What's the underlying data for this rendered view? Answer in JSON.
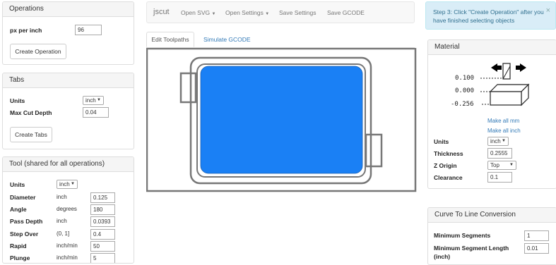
{
  "operations": {
    "title": "Operations",
    "px_per_inch_label": "px per inch",
    "px_per_inch_value": "96",
    "create_button": "Create Operation"
  },
  "tabs_panel": {
    "title": "Tabs",
    "units_label": "Units",
    "units_value": "inch",
    "max_cut_depth_label": "Max Cut Depth",
    "max_cut_depth_value": "0.04",
    "create_button": "Create Tabs"
  },
  "tool": {
    "title": "Tool (shared for all operations)",
    "units_label": "Units",
    "units_value": "inch",
    "rows": [
      {
        "label": "Diameter",
        "unit": "inch",
        "value": "0.125"
      },
      {
        "label": "Angle",
        "unit": "degrees",
        "value": "180"
      },
      {
        "label": "Pass Depth",
        "unit": "inch",
        "value": "0.0393"
      },
      {
        "label": "Step Over",
        "unit": "(0, 1]",
        "value": "0.4"
      },
      {
        "label": "Rapid",
        "unit": "inch/min",
        "value": "50"
      },
      {
        "label": "Plunge",
        "unit": "inch/min",
        "value": "5"
      }
    ]
  },
  "navbar": {
    "brand": "jscut",
    "open_svg": "Open SVG",
    "open_settings": "Open Settings",
    "save_settings": "Save Settings",
    "save_gcode": "Save GCODE"
  },
  "center_tabs": {
    "edit_toolpaths": "Edit Toolpaths",
    "simulate_gcode": "Simulate GCODE"
  },
  "canvas": {
    "shape_fill": "#1a80f5",
    "stroke_color": "#777777"
  },
  "alert": {
    "text": "Step 3: Click \"Create Operation\" after you have finished selecting objects",
    "close": "×"
  },
  "material": {
    "title": "Material",
    "diagram": {
      "top_value": "0.100",
      "mid_value": "0.000",
      "bottom_value": "-0.256"
    },
    "make_all_mm": "Make all mm",
    "make_all_inch": "Make all inch",
    "units_label": "Units",
    "units_value": "inch",
    "thickness_label": "Thickness",
    "thickness_value": "0.2555",
    "z_origin_label": "Z Origin",
    "z_origin_value": "Top",
    "clearance_label": "Clearance",
    "clearance_value": "0.1"
  },
  "curve": {
    "title": "Curve To Line Conversion",
    "min_segments_label": "Minimum Segments",
    "min_segments_value": "1",
    "min_segment_length_label": "Minimum Segment Length",
    "min_segment_length_unit": "(inch)",
    "min_segment_length_value": "0.01"
  }
}
